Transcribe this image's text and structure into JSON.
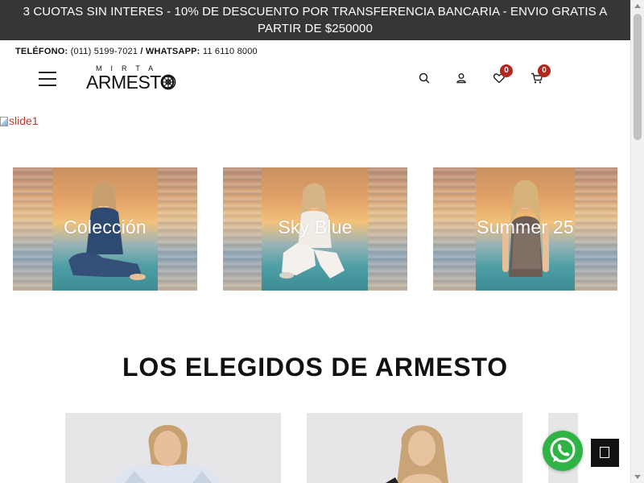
{
  "promo_bar": {
    "text": "3 CUOTAS SIN INTERES - 10% DE DESCUENTO POR TRANSFERENCIA BANCARIA - ENVIO GRATIS A PARTIR DE $250000"
  },
  "contact": {
    "phone_label": "TELÉFONO:",
    "phone": "(011) 5199-7021",
    "separator": "/",
    "whatsapp_label": "WHATSAPP:",
    "whatsapp": "11 6110 8000"
  },
  "header": {
    "logo_small": "MIRTA",
    "logo_big": "ARMESTO",
    "wishlist_count": "0",
    "cart_count": "0",
    "icons": [
      "menu-icon",
      "search-icon",
      "user-icon",
      "heart-icon",
      "cart-icon"
    ]
  },
  "slider": {
    "alt_text": "slide1"
  },
  "banners": [
    {
      "label": "Colección"
    },
    {
      "label": "Sky Blue"
    },
    {
      "label": "Summer 25"
    }
  ],
  "section": {
    "title": "LOS ELEGIDOS DE ARMESTO"
  },
  "colors": {
    "promo_bg": "#363636",
    "badge": "#b2281e",
    "whatsapp": "#2fb344",
    "link_red": "#c0392b"
  }
}
